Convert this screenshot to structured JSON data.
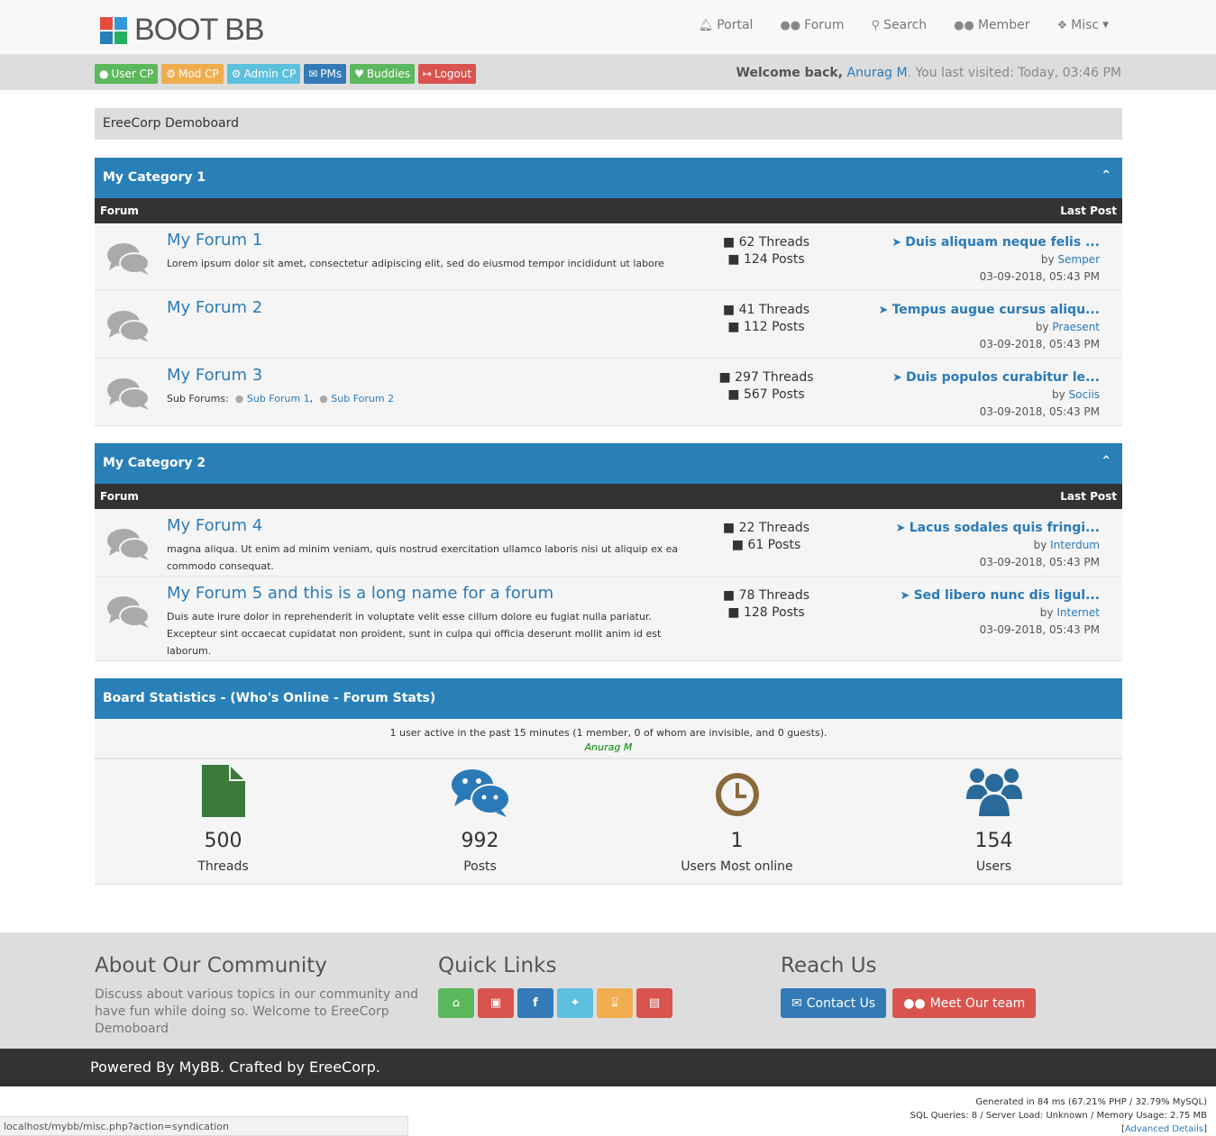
{
  "brand": {
    "name": "BOOT BB"
  },
  "nav": [
    {
      "label": "Portal",
      "icon": "bell-icon"
    },
    {
      "label": "Forum",
      "icon": "users-icon"
    },
    {
      "label": "Search",
      "icon": "search-icon"
    },
    {
      "label": "Member",
      "icon": "users-icon"
    },
    {
      "label": "Misc",
      "icon": "cubes-icon"
    }
  ],
  "userbar": {
    "buttons": [
      {
        "label": "User CP",
        "color": "#5cb85c"
      },
      {
        "label": "Mod CP",
        "color": "#f0ad4e"
      },
      {
        "label": "Admin CP",
        "color": "#5bc0de"
      },
      {
        "label": "PMs",
        "color": "#337ab7"
      },
      {
        "label": "Buddies",
        "color": "#5cb85c"
      },
      {
        "label": "Logout",
        "color": "#d9534f"
      }
    ],
    "welcome_prefix": "Welcome back,",
    "username": "Anurag M",
    "welcome_suffix": ". You last visited: Today, 03:46 PM"
  },
  "breadcrumb": "EreeCorp Demoboard",
  "table_headers": {
    "forum": "Forum",
    "last_post": "Last Post"
  },
  "categories": [
    {
      "name": "My Category 1",
      "forums": [
        {
          "title": "My Forum 1",
          "desc": "Lorem ipsum dolor sit amet, consectetur adipiscing elit, sed do eiusmod tempor incididunt ut labore",
          "threads": "62 Threads",
          "posts": "124 Posts",
          "lp_title": "Duis aliquam neque felis ...",
          "lp_by": "by",
          "lp_user": "Semper",
          "lp_date": "03-09-2018, 05:43 PM"
        },
        {
          "title": "My Forum 2",
          "desc": "",
          "threads": "41 Threads",
          "posts": "112 Posts",
          "lp_title": "Tempus augue cursus aliqu...",
          "lp_by": "by",
          "lp_user": "Praesent",
          "lp_date": "03-09-2018, 05:43 PM"
        },
        {
          "title": "My Forum 3",
          "sub_label": "Sub Forums:",
          "sub1": "Sub Forum 1",
          "sub2": "Sub Forum 2",
          "threads": "297 Threads",
          "posts": "567 Posts",
          "lp_title": "Duis populos curabitur le...",
          "lp_by": "by",
          "lp_user": "Sociis",
          "lp_date": "03-09-2018, 05:43 PM"
        }
      ]
    },
    {
      "name": "My Category 2",
      "forums": [
        {
          "title": "My Forum 4",
          "desc": "magna aliqua. Ut enim ad minim veniam, quis nostrud exercitation ullamco laboris nisi ut aliquip ex ea commodo consequat.",
          "threads": "22 Threads",
          "posts": "61 Posts",
          "lp_title": "Lacus sodales quis fringi...",
          "lp_by": "by",
          "lp_user": "Interdum",
          "lp_date": "03-09-2018, 05:43 PM"
        },
        {
          "title": "My Forum 5 and this is a long name for a forum",
          "desc": "Duis aute irure dolor in reprehenderit in voluptate velit esse cillum dolore eu fugiat nulla pariatur. Excepteur sint occaecat cupidatat non proident, sunt in culpa qui officia deserunt mollit anim id est laborum.",
          "threads": "78 Threads",
          "posts": "128 Posts",
          "lp_title": "Sed libero nunc dis ligul...",
          "lp_by": "by",
          "lp_user": "Internet",
          "lp_date": "03-09-2018, 05:43 PM"
        }
      ]
    }
  ],
  "stats": {
    "title": "Board Statistics - (Who's Online - Forum Stats)",
    "online_text": "1 user active in the past 15 minutes (1 member, 0 of whom are invisible, and 0 guests).",
    "online_user": "Anurag M",
    "items": [
      {
        "value": "500",
        "label": "Threads",
        "icon": "file-icon",
        "color": "#3a7a3a"
      },
      {
        "value": "992",
        "label": "Posts",
        "icon": "wechat-icon",
        "color": "#2a7ab8"
      },
      {
        "value": "1",
        "label": "Users Most online",
        "icon": "clock-icon",
        "color": "#8a6a3a"
      },
      {
        "value": "154",
        "label": "Users",
        "icon": "users-icon",
        "color": "#2a6a9a"
      }
    ]
  },
  "footer": {
    "about_title": "About Our Community",
    "about_text": "Discuss about various topics in our community and have fun while doing so. Welcome to EreeCorp Demoboard",
    "links_title": "Quick Links",
    "quick_links": [
      {
        "icon": "home-icon",
        "color": "#5cb85c"
      },
      {
        "icon": "archive-icon",
        "color": "#d9534f"
      },
      {
        "icon": "facebook-icon",
        "color": "#337ab7"
      },
      {
        "icon": "twitter-icon",
        "color": "#5bc0de"
      },
      {
        "icon": "rss-icon",
        "color": "#f0ad4e"
      },
      {
        "icon": "book-icon",
        "color": "#d9534f"
      }
    ],
    "reach_title": "Reach Us",
    "contact_label": "Contact Us",
    "team_label": "Meet Our team",
    "powered": "Powered By MyBB. Crafted by EreeCorp."
  },
  "debug": {
    "line1": "Generated in 84 ms (67.21% PHP / 32.79% MySQL)",
    "line2": "SQL Queries: 8 / Server Load: Unknown / Memory Usage: 2.75 MB",
    "line3": "Advanced Details"
  },
  "status_url": "localhost/mybb/misc.php?action=syndication"
}
